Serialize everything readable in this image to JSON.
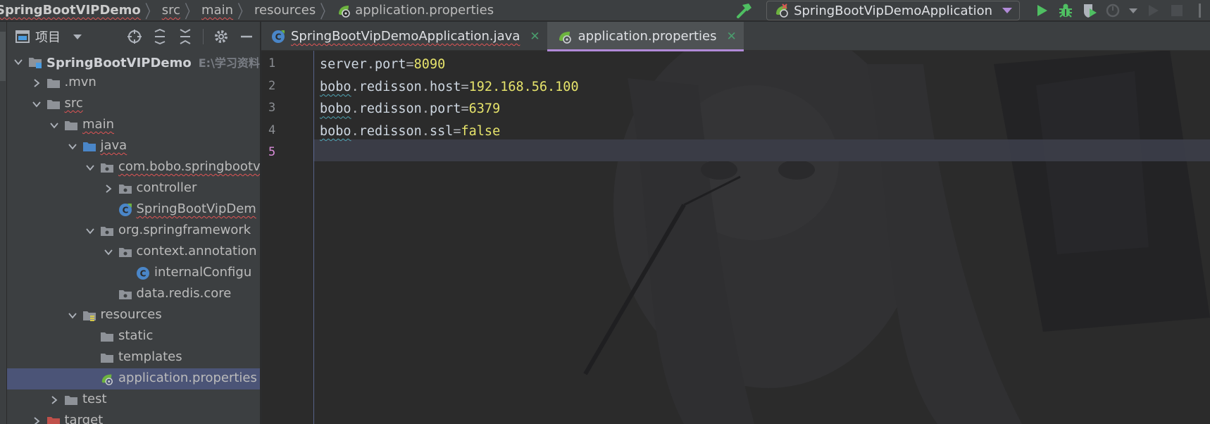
{
  "breadcrumb": {
    "project": "SpringBootVIPDemo",
    "items": [
      "src",
      "main",
      "resources"
    ],
    "file": "application.properties"
  },
  "toolbar": {
    "run_config": "SpringBootVipDemoApplication",
    "icons": [
      "build-hammer-icon",
      "run-icon",
      "debug-icon",
      "coverage-icon",
      "profile-icon",
      "more-dropdown-icon",
      "attach-icon",
      "stop-icon"
    ]
  },
  "project_panel": {
    "title": "项目",
    "tools": [
      "locate-icon",
      "expand-all-icon",
      "collapse-all-icon",
      "settings-icon",
      "hide-icon"
    ]
  },
  "tree": [
    {
      "label": "SpringBootVIPDemo",
      "path": "E:\\学习资料\\",
      "depth": 0,
      "expanded": true,
      "icon": "module-folder",
      "bold": true
    },
    {
      "label": ".mvn",
      "depth": 1,
      "expanded": false,
      "icon": "folder"
    },
    {
      "label": "src",
      "depth": 1,
      "expanded": true,
      "icon": "folder",
      "squiggle": true
    },
    {
      "label": "main",
      "depth": 2,
      "expanded": true,
      "icon": "folder",
      "squiggle": true
    },
    {
      "label": "java",
      "depth": 3,
      "expanded": true,
      "icon": "source-folder",
      "squiggle": true
    },
    {
      "label": "com.bobo.springbootv",
      "depth": 4,
      "expanded": true,
      "icon": "package",
      "squiggle": true
    },
    {
      "label": "controller",
      "depth": 5,
      "expanded": false,
      "icon": "package"
    },
    {
      "label": "SpringBootVipDem",
      "depth": 5,
      "icon": "spring-class",
      "squiggle": true
    },
    {
      "label": "org.springframework",
      "depth": 4,
      "expanded": true,
      "icon": "package"
    },
    {
      "label": "context.annotation",
      "depth": 5,
      "expanded": true,
      "icon": "package"
    },
    {
      "label": "internalConfigu",
      "depth": 6,
      "icon": "class"
    },
    {
      "label": "data.redis.core",
      "depth": 5,
      "icon": "package"
    },
    {
      "label": "resources",
      "depth": 3,
      "expanded": true,
      "icon": "resources-folder"
    },
    {
      "label": "static",
      "depth": 4,
      "icon": "folder"
    },
    {
      "label": "templates",
      "depth": 4,
      "icon": "folder"
    },
    {
      "label": "application.properties",
      "depth": 4,
      "icon": "spring-properties",
      "selected": true
    },
    {
      "label": "test",
      "depth": 2,
      "expanded": false,
      "icon": "folder"
    },
    {
      "label": "target",
      "depth": 1,
      "expanded": false,
      "icon": "excluded-folder"
    }
  ],
  "tabs": [
    {
      "label": "SpringBootVipDemoApplication.java",
      "active": false,
      "squiggle": true
    },
    {
      "label": "application.properties",
      "active": true
    }
  ],
  "editor": {
    "lines": [
      {
        "no": "1",
        "tokens": [
          {
            "t": "server",
            "c": "k"
          },
          {
            "t": ".",
            "c": "op"
          },
          {
            "t": "port",
            "c": "k"
          },
          {
            "t": "=",
            "c": "op"
          },
          {
            "t": "8090",
            "c": "v"
          }
        ]
      },
      {
        "no": "2",
        "tokens": [
          {
            "t": "bobo",
            "c": "kw"
          },
          {
            "t": ".",
            "c": "op"
          },
          {
            "t": "redisson",
            "c": "k"
          },
          {
            "t": ".",
            "c": "op"
          },
          {
            "t": "host",
            "c": "k"
          },
          {
            "t": "=",
            "c": "op"
          },
          {
            "t": "192.168.56.100",
            "c": "v"
          }
        ]
      },
      {
        "no": "3",
        "tokens": [
          {
            "t": "bobo",
            "c": "kw"
          },
          {
            "t": ".",
            "c": "op"
          },
          {
            "t": "redisson",
            "c": "k"
          },
          {
            "t": ".",
            "c": "op"
          },
          {
            "t": "port",
            "c": "k"
          },
          {
            "t": "=",
            "c": "op"
          },
          {
            "t": "6379",
            "c": "v"
          }
        ]
      },
      {
        "no": "4",
        "tokens": [
          {
            "t": "bobo",
            "c": "kw"
          },
          {
            "t": ".",
            "c": "op"
          },
          {
            "t": "redisson",
            "c": "k"
          },
          {
            "t": ".",
            "c": "op"
          },
          {
            "t": "ssl",
            "c": "k"
          },
          {
            "t": "=",
            "c": "op"
          },
          {
            "t": "false",
            "c": "v"
          }
        ]
      },
      {
        "no": "5",
        "tokens": [],
        "current": true
      }
    ]
  },
  "colors": {
    "accent_tab": "#b18ad8",
    "selection": "#4b5477",
    "value_yellow": "#e6e36b",
    "run_green": "#4fbf62"
  }
}
